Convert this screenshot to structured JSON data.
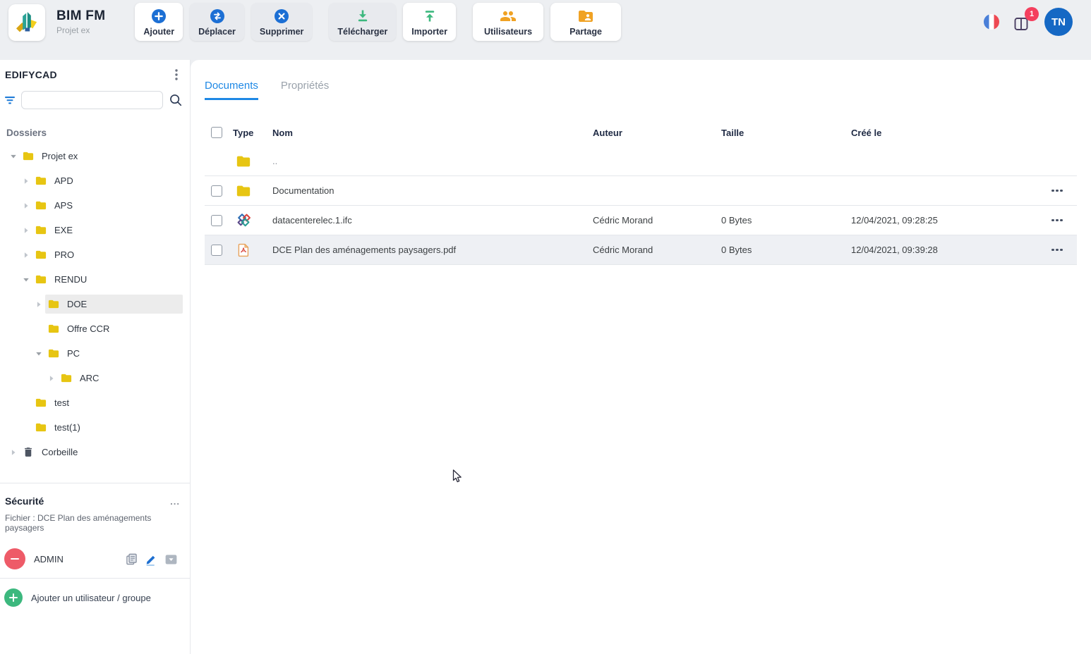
{
  "colors": {
    "accent_blue": "#1c6fd4",
    "tab_blue": "#1e88e5",
    "green": "#3cb87e",
    "orange": "#f0a224",
    "folder_yellow": "#e7c512",
    "badge_red": "#f43f5e",
    "avatar_blue": "#1568c4"
  },
  "app": {
    "title": "BIM FM",
    "subtitle": "Projet ex"
  },
  "toolbar": {
    "buttons": [
      {
        "label": "Ajouter",
        "icon": "add-icon",
        "enabled": true,
        "group_break": false,
        "wide": false
      },
      {
        "label": "Déplacer",
        "icon": "move-icon",
        "enabled": false,
        "group_break": false,
        "wide": false
      },
      {
        "label": "Supprimer",
        "icon": "delete-icon",
        "enabled": false,
        "group_break": false,
        "wide": false
      },
      {
        "label": "Télécharger",
        "icon": "download-icon",
        "enabled": false,
        "group_break": true,
        "wide": false
      },
      {
        "label": "Importer",
        "icon": "upload-icon",
        "enabled": true,
        "group_break": false,
        "wide": false
      },
      {
        "label": "Utilisateurs",
        "icon": "users-icon",
        "enabled": true,
        "group_break": true,
        "wide": true
      },
      {
        "label": "Partage",
        "icon": "share-folder-icon",
        "enabled": true,
        "group_break": false,
        "wide": true
      }
    ]
  },
  "header_right": {
    "language": "french-flag",
    "notification_count": "1",
    "avatar_initials": "TN"
  },
  "sidebar": {
    "brand": "EDIFYCAD",
    "search": {
      "value": ""
    },
    "folders_title": "Dossiers",
    "tree": [
      {
        "label": "Projet ex",
        "level": 0,
        "caret": "expanded",
        "icon": "folder",
        "selected": false
      },
      {
        "label": "APD",
        "level": 1,
        "caret": "collapsed",
        "icon": "folder",
        "selected": false
      },
      {
        "label": "APS",
        "level": 1,
        "caret": "collapsed",
        "icon": "folder",
        "selected": false
      },
      {
        "label": "EXE",
        "level": 1,
        "caret": "collapsed",
        "icon": "folder",
        "selected": false
      },
      {
        "label": "PRO",
        "level": 1,
        "caret": "collapsed",
        "icon": "folder",
        "selected": false
      },
      {
        "label": "RENDU",
        "level": 1,
        "caret": "expanded",
        "icon": "folder",
        "selected": false
      },
      {
        "label": "DOE",
        "level": 2,
        "caret": "collapsed",
        "icon": "folder",
        "selected": true
      },
      {
        "label": "Offre CCR",
        "level": 2,
        "caret": "none",
        "icon": "folder",
        "selected": false
      },
      {
        "label": "PC",
        "level": 2,
        "caret": "expanded",
        "icon": "folder",
        "selected": false
      },
      {
        "label": "ARC",
        "level": 3,
        "caret": "collapsed",
        "icon": "folder",
        "selected": false
      },
      {
        "label": "test",
        "level": 1,
        "caret": "none",
        "icon": "folder",
        "selected": false
      },
      {
        "label": "test(1)",
        "level": 1,
        "caret": "none",
        "icon": "folder",
        "selected": false
      },
      {
        "label": "Corbeille",
        "level": 0,
        "caret": "collapsed",
        "icon": "trash",
        "selected": false
      }
    ],
    "security": {
      "title": "Sécurité",
      "more": "...",
      "file_label": "Fichier : DCE Plan des aménagements paysagers",
      "entries": [
        {
          "name": "ADMIN",
          "icons": [
            "copy-icon",
            "edit-icon",
            "dropdown-icon"
          ]
        }
      ],
      "add_label": "Ajouter un utilisateur / groupe"
    }
  },
  "main": {
    "tabs": [
      {
        "label": "Documents",
        "active": true
      },
      {
        "label": "Propriétés",
        "active": false
      }
    ],
    "table": {
      "columns": {
        "type": "Type",
        "name": "Nom",
        "author": "Auteur",
        "size": "Taille",
        "created": "Créé le"
      },
      "rows": [
        {
          "type": "folder",
          "name": "..",
          "author": "",
          "size": "",
          "created": "",
          "checkbox": false,
          "actions": false,
          "highlighted": false,
          "dim_name": true
        },
        {
          "type": "folder",
          "name": "Documentation",
          "author": "",
          "size": "",
          "created": "",
          "checkbox": true,
          "actions": true,
          "highlighted": false,
          "dim_name": false
        },
        {
          "type": "ifc",
          "name": "datacenterelec.1.ifc",
          "author": "Cédric Morand",
          "size": "0 Bytes",
          "created": "12/04/2021, 09:28:25",
          "checkbox": true,
          "actions": true,
          "highlighted": false,
          "dim_name": false
        },
        {
          "type": "pdf",
          "name": "DCE Plan des aménagements paysagers.pdf",
          "author": "Cédric Morand",
          "size": "0 Bytes",
          "created": "12/04/2021, 09:39:28",
          "checkbox": true,
          "actions": true,
          "highlighted": true,
          "dim_name": false
        }
      ]
    }
  }
}
